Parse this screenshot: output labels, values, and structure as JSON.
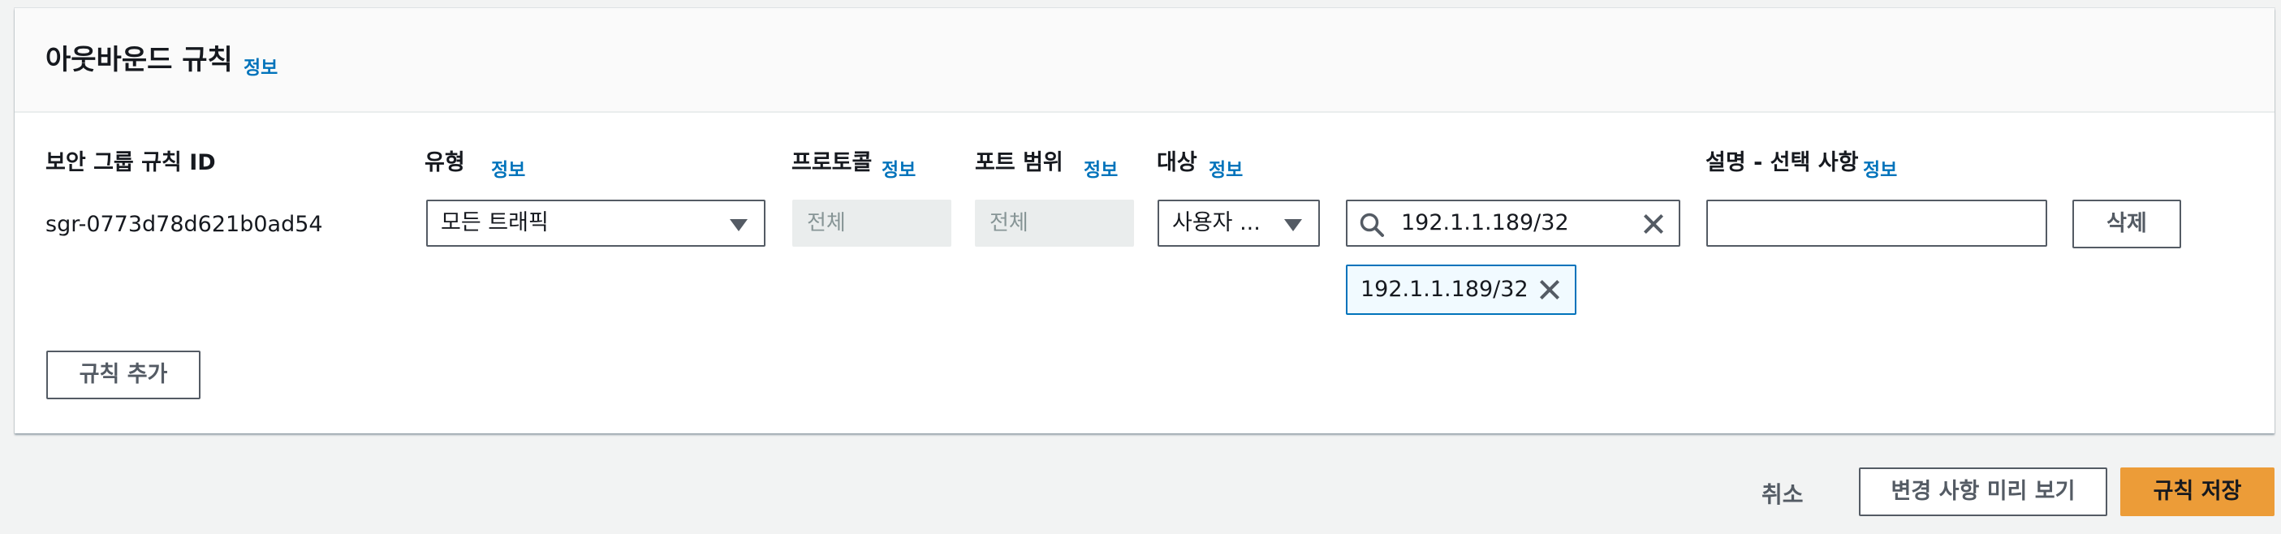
{
  "section": {
    "title": "아웃바운드 규칙",
    "info": "정보"
  },
  "columns": {
    "rule_id": "보안 그룹 규칙 ID",
    "type": "유형",
    "type_info": "정보",
    "protocol": "프로토콜",
    "protocol_info": "정보",
    "port_range": "포트 범위",
    "port_range_info": "정보",
    "destination": "대상",
    "destination_info": "정보",
    "description": "설명 - 선택 사항",
    "description_info": "정보"
  },
  "rule": {
    "id": "sgr-0773d78d621b0ad54",
    "type_value": "모든 트래픽",
    "protocol_value": "전체",
    "port_range_value": "전체",
    "destination_type": "사용자 ...",
    "destination_search": "192.1.1.189/32",
    "destination_token": "192.1.1.189/32",
    "description_value": "",
    "delete_label": "삭제"
  },
  "add_rule_label": "규칙 추가",
  "footer": {
    "cancel": "취소",
    "preview": "변경 사항 미리 보기",
    "save": "규칙 저장"
  },
  "icons": {
    "search": "search-icon",
    "clear": "close-icon",
    "dropdown": "caret-down-icon"
  },
  "colors": {
    "link": "#0073bb",
    "primary": "#ec9c38",
    "border": "#545b64"
  }
}
